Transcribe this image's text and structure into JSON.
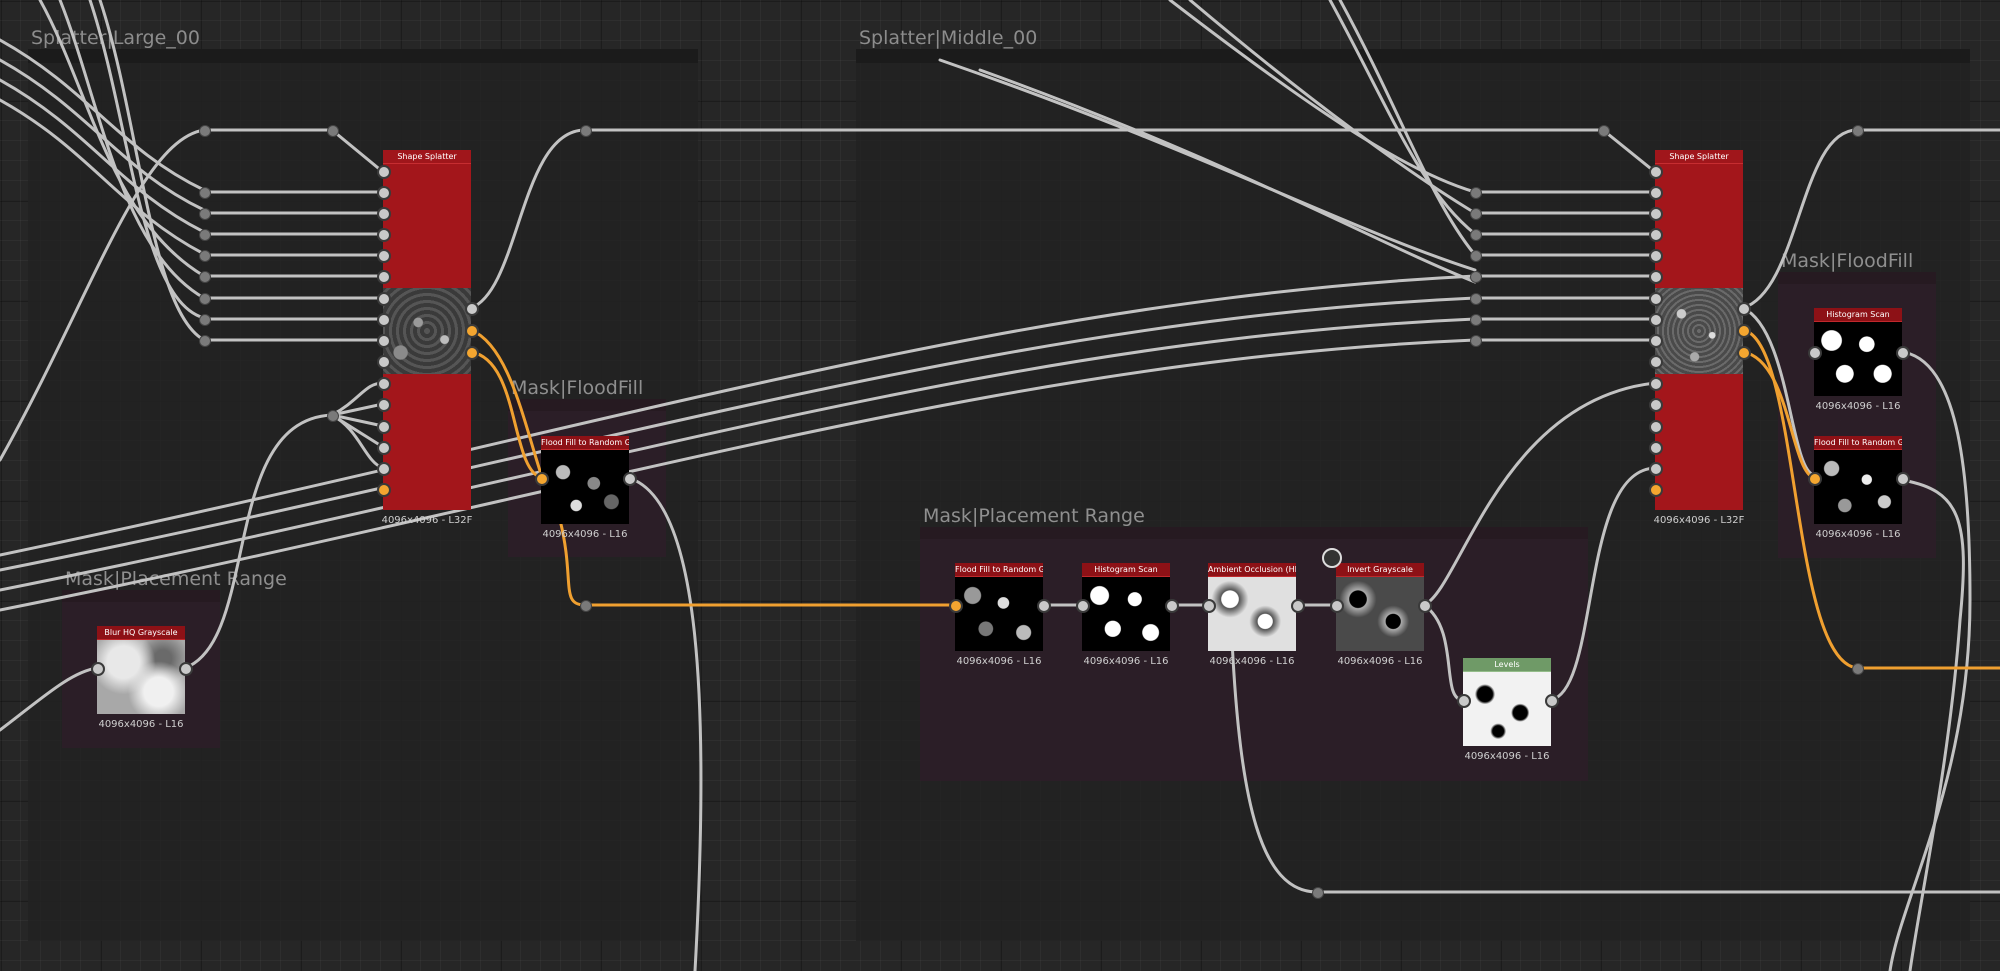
{
  "frames": [
    {
      "id": "large",
      "title": "Splatter|Large_00"
    },
    {
      "id": "middle",
      "title": "Splatter|Middle_00"
    }
  ],
  "groups": [
    {
      "id": "g-floodfill-left",
      "title": "Mask|FloodFill"
    },
    {
      "id": "g-placement-left",
      "title": "Mask|Placement Range"
    },
    {
      "id": "g-placement-mid",
      "title": "Mask|Placement Range"
    },
    {
      "id": "g-floodfill-right",
      "title": "Mask|FloodFill"
    }
  ],
  "nodes": {
    "shape_splatter_left": {
      "title": "Shape Splatter",
      "caption": "4096x4096 - L32F"
    },
    "shape_splatter_right": {
      "title": "Shape Splatter",
      "caption": "4096x4096 - L32F"
    },
    "flood_fill_left": {
      "title": "Flood Fill to Random Gr",
      "caption": "4096x4096 - L16"
    },
    "blur_hq": {
      "title": "Blur HQ Grayscale",
      "caption": "4096x4096 - L16"
    },
    "flood_fill_mid": {
      "title": "Flood Fill to Random Gr",
      "caption": "4096x4096 - L16"
    },
    "histogram_scan_mid": {
      "title": "Histogram Scan",
      "caption": "4096x4096 - L16"
    },
    "ambient_occlusion": {
      "title": "Ambient Occlusion (HB",
      "caption": "4096x4096 - L16"
    },
    "invert_grayscale": {
      "title": "Invert Grayscale",
      "caption": "4096x4096 - L16"
    },
    "levels": {
      "title": "Levels",
      "caption": "4096x4096 - L16"
    },
    "histogram_scan_right": {
      "title": "Histogram Scan",
      "caption": "4096x4096 - L16"
    },
    "flood_fill_right": {
      "title": "Flood Fill to Random Gr",
      "caption": "4096x4096 - L16"
    }
  },
  "colors": {
    "wire": "#c2c2c2",
    "wire_active": "#f0a030",
    "node_header": "#8d1116",
    "levels_header": "#6f9a67"
  }
}
